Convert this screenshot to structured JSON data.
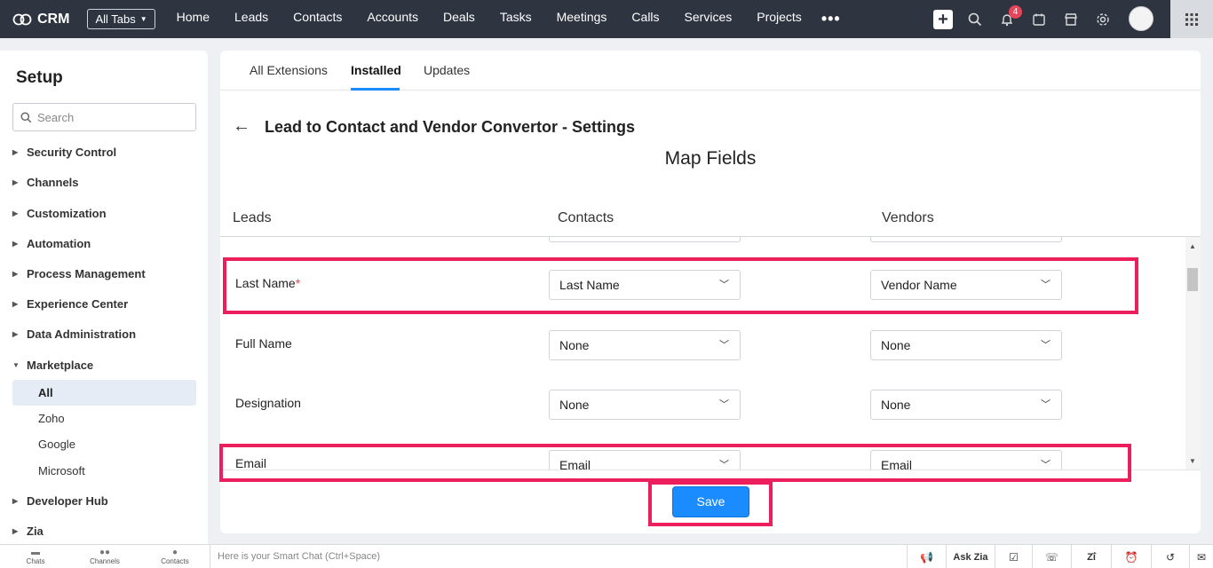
{
  "topbar": {
    "app_name": "CRM",
    "all_tabs_label": "All Tabs",
    "nav": [
      "Home",
      "Leads",
      "Contacts",
      "Accounts",
      "Deals",
      "Tasks",
      "Meetings",
      "Calls",
      "Services",
      "Projects"
    ],
    "notification_count": "4"
  },
  "sidebar": {
    "title": "Setup",
    "search_placeholder": "Search",
    "items": [
      "Security Control",
      "Channels",
      "Customization",
      "Automation",
      "Process Management",
      "Experience Center",
      "Data Administration",
      "Marketplace",
      "Developer Hub",
      "Zia"
    ],
    "marketplace_sub": [
      "All",
      "Zoho",
      "Google",
      "Microsoft"
    ],
    "active_sub": "All"
  },
  "main": {
    "tabs": [
      "All Extensions",
      "Installed",
      "Updates"
    ],
    "active_tab": "Installed",
    "page_title": "Lead to Contact and Vendor Convertor - Settings",
    "section_title": "Map Fields",
    "columns": [
      "Leads",
      "Contacts",
      "Vendors"
    ],
    "rows": [
      {
        "lead": "Last Name",
        "required": "*",
        "contact": "Last Name",
        "vendor": "Vendor Name"
      },
      {
        "lead": "Full Name",
        "contact": "None",
        "vendor": "None"
      },
      {
        "lead": "Designation",
        "contact": "None",
        "vendor": "None"
      },
      {
        "lead": "Email",
        "contact": "Email",
        "vendor": "Email"
      }
    ],
    "save_label": "Save"
  },
  "bottombar": {
    "buttons": [
      "Chats",
      "Channels",
      "Contacts"
    ],
    "smart_chat_placeholder": "Here is your Smart Chat (Ctrl+Space)",
    "ask_zia": "Ask Zia"
  },
  "colors": {
    "accent": "#1a8cff",
    "topbar": "#2e3440",
    "highlight": "#ec1e5c"
  }
}
